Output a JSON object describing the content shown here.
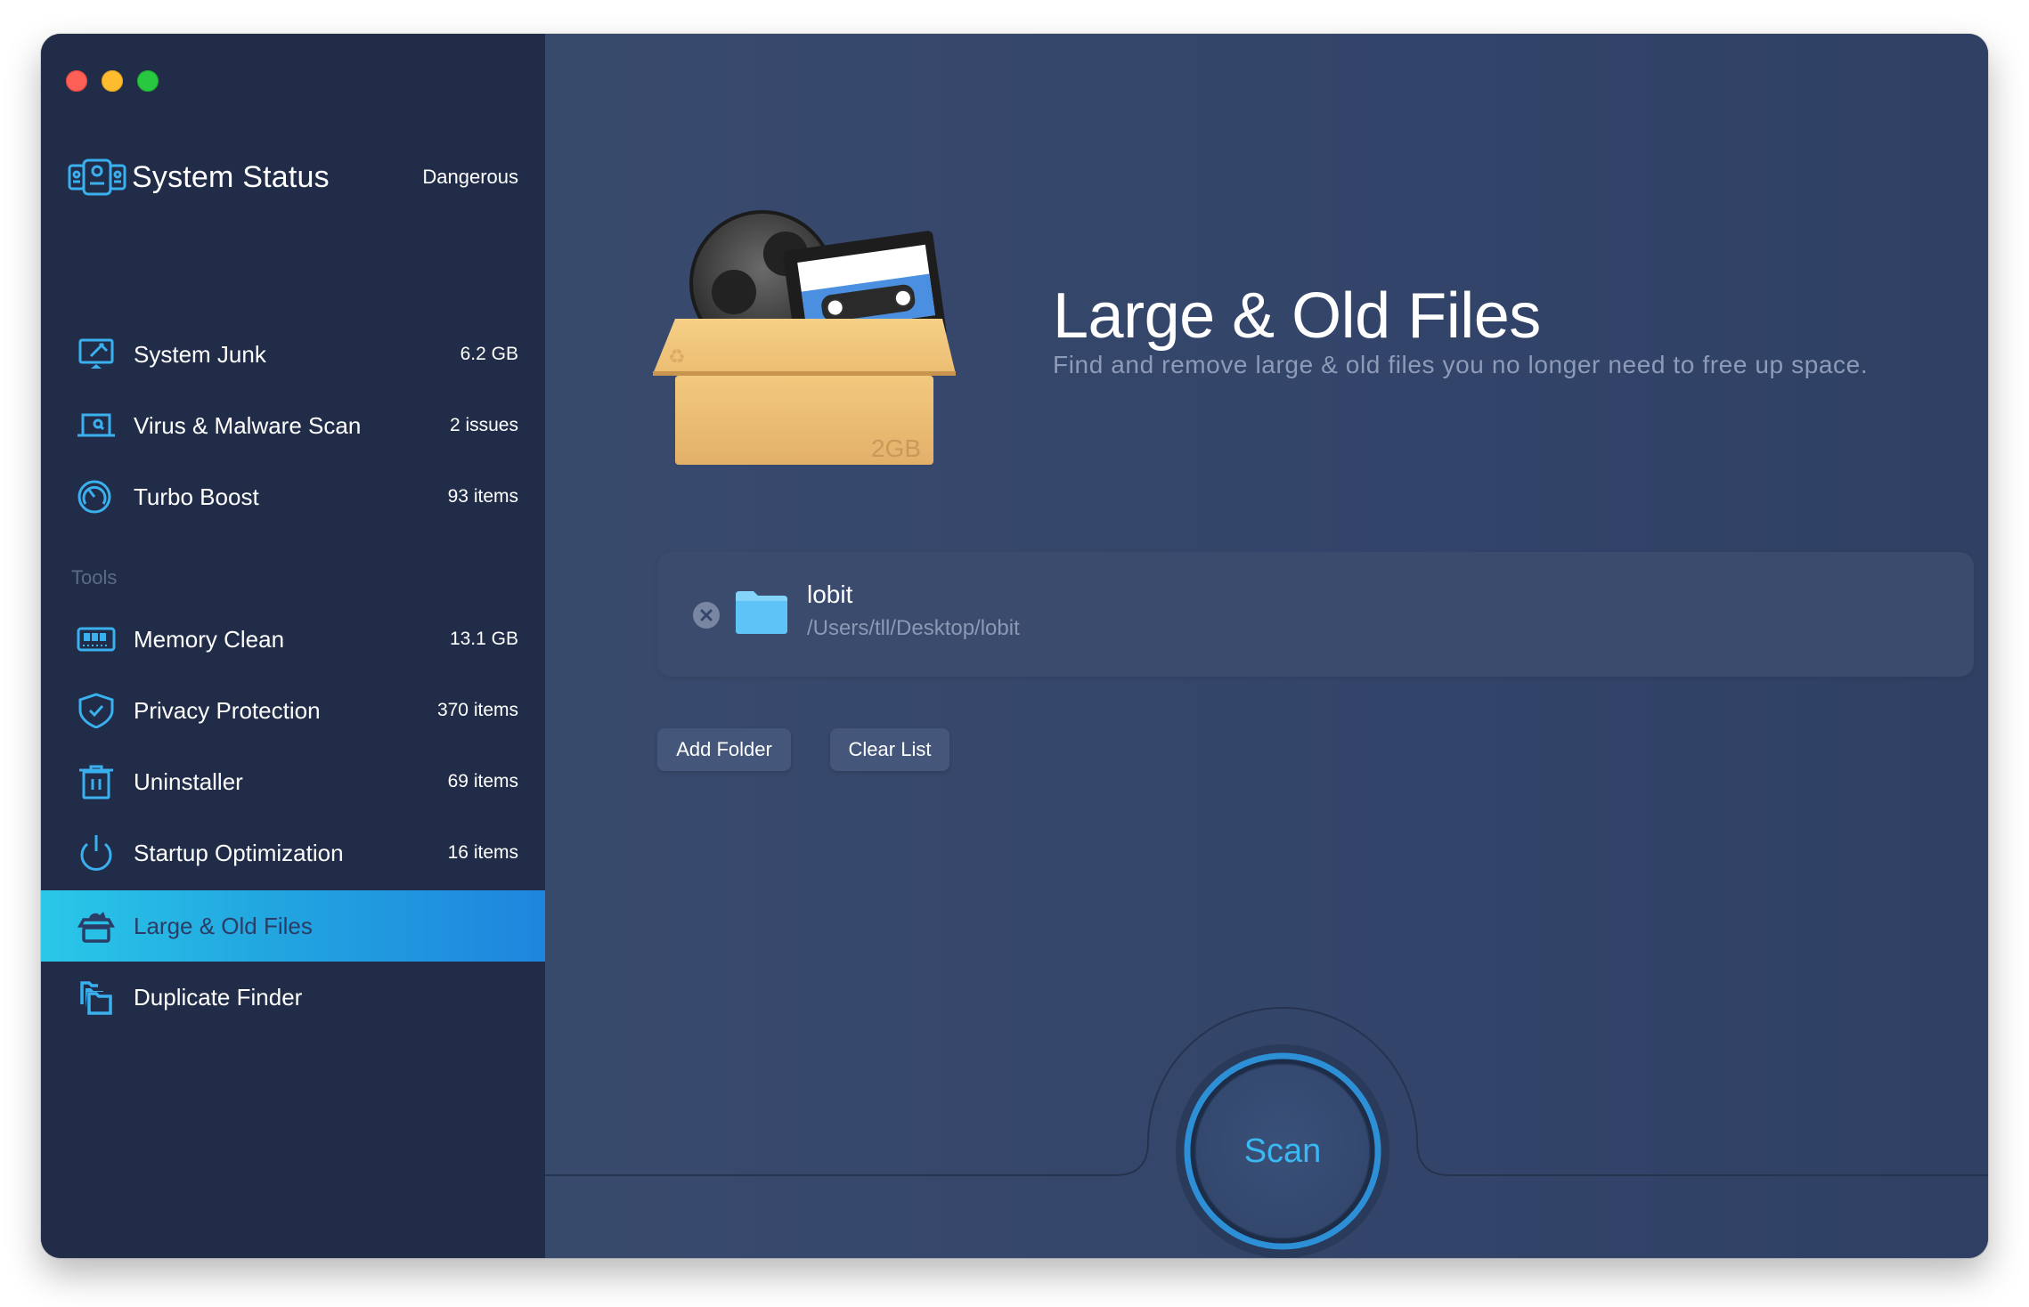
{
  "window": {
    "controls": [
      "close",
      "minimize",
      "zoom"
    ]
  },
  "sidebar": {
    "status": {
      "title": "System Status",
      "state": "Dangerous",
      "icon": "system-status-icon"
    },
    "items": [
      {
        "label": "System Junk",
        "value": "6.2 GB",
        "icon": "monitor-broom-icon"
      },
      {
        "label": "Virus & Malware Scan",
        "value": "2 issues",
        "icon": "laptop-search-icon"
      },
      {
        "label": "Turbo Boost",
        "value": "93 items",
        "icon": "speedometer-icon"
      }
    ],
    "tools_label": "Tools",
    "tools": [
      {
        "label": "Memory Clean",
        "value": "13.1 GB",
        "icon": "memory-chip-icon"
      },
      {
        "label": "Privacy Protection",
        "value": "370 items",
        "icon": "shield-check-icon"
      },
      {
        "label": "Uninstaller",
        "value": "69 items",
        "icon": "trash-icon"
      },
      {
        "label": "Startup Optimization",
        "value": "16 items",
        "icon": "power-icon"
      },
      {
        "label": "Large & Old Files",
        "value": "",
        "icon": "box-icon",
        "active": true
      },
      {
        "label": "Duplicate Finder",
        "value": "",
        "icon": "folders-icon"
      }
    ]
  },
  "main": {
    "title": "Large & Old Files",
    "subtitle": "Find and remove large & old files you no longer need to free up space.",
    "hero_badge": "2GB",
    "folders": [
      {
        "name": "lobit",
        "path": "/Users/tll/Desktop/lobit"
      }
    ],
    "add_folder_label": "Add Folder",
    "clear_list_label": "Clear List",
    "scan_label": "Scan"
  },
  "colors": {
    "accent": "#3ab8f3",
    "active_gradient_start": "#2ac8e8",
    "active_gradient_end": "#1e85de",
    "sidebar_bg": "#212d48",
    "main_bg": "#34466a"
  }
}
